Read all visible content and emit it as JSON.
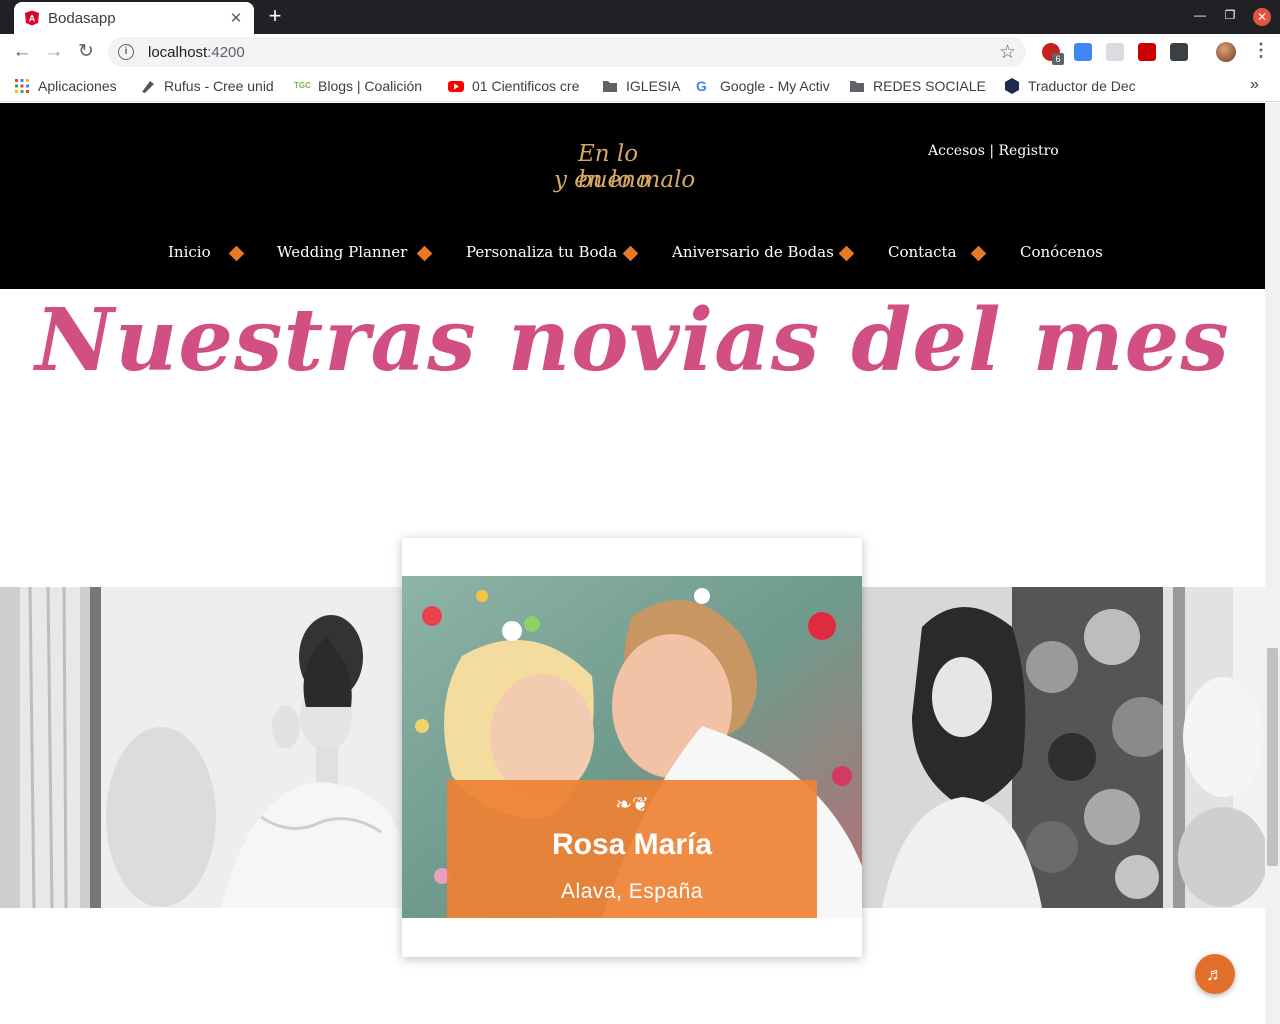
{
  "browser": {
    "tab_title": "Bodasapp",
    "url_host": "localhost",
    "url_port": ":4200",
    "window_controls": [
      "minimize-icon",
      "restore-icon",
      "close-icon"
    ],
    "extension_badge": "6",
    "bookmarks": [
      {
        "label": "Aplicaciones",
        "icon": "apps-grid-icon"
      },
      {
        "label": "Rufus - Cree unid",
        "icon": "rufus-icon"
      },
      {
        "label": "Blogs | Coalición",
        "icon": "tgc-icon"
      },
      {
        "label": "01 Cientificos cre",
        "icon": "youtube-icon"
      },
      {
        "label": "IGLESIA",
        "icon": "folder-icon"
      },
      {
        "label": "Google - My Activ",
        "icon": "google-icon"
      },
      {
        "label": "REDES SOCIALES",
        "icon": "folder-icon"
      },
      {
        "label": "Traductor de Dec",
        "icon": "translator-icon"
      }
    ],
    "bookmarks_more": "»"
  },
  "site": {
    "logo_line1": "En lo bueno",
    "logo_line2": "y en lo malo",
    "auth_login": "Accesos",
    "auth_sep": " | ",
    "auth_register": "Registro",
    "menu": [
      "Inicio",
      "Wedding Planner",
      "Personaliza tu Boda",
      "Aniversario de Bodas",
      "Contacta",
      "Conócenos"
    ],
    "accent_color": "#e87a26",
    "title_color": "#d14f82"
  },
  "main": {
    "title": "Nuestras novias del mes",
    "featured": {
      "ornament": "❧❦",
      "name": "Rosa María",
      "place": "Alava, España"
    },
    "music_icon": "♬"
  }
}
